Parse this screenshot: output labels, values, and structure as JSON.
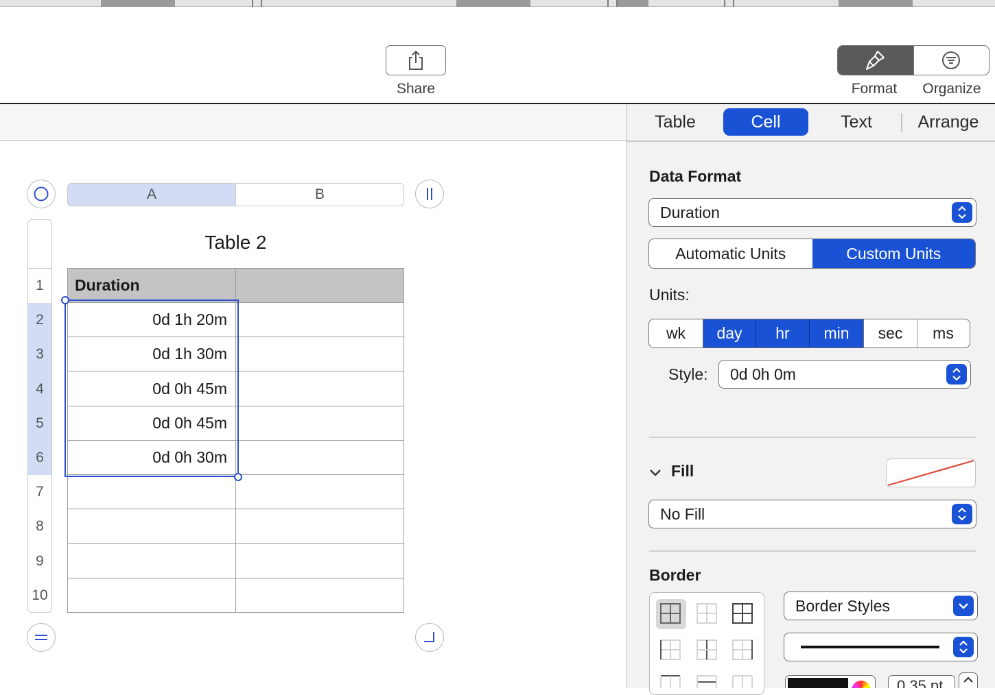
{
  "toolbar": {
    "share_label": "Share",
    "format_label": "Format",
    "organize_label": "Organize",
    "share_icon": "share-icon",
    "format_icon": "paintbrush-icon",
    "organize_icon": "organize-icon"
  },
  "table": {
    "title": "Table 2",
    "columns": [
      "A",
      "B"
    ],
    "row_numbers": [
      "1",
      "2",
      "3",
      "4",
      "5",
      "6",
      "7",
      "8",
      "9",
      "10"
    ],
    "header_cell": "Duration",
    "values": [
      "0d 1h 20m",
      "0d 1h 30m",
      "0d 0h 45m",
      "0d 0h 45m",
      "0d 0h 30m"
    ]
  },
  "sidebar": {
    "tabs": [
      "Table",
      "Cell",
      "Text",
      "Arrange"
    ],
    "active_tab": "Cell",
    "data_format_title": "Data Format",
    "data_format_value": "Duration",
    "unit_modes": [
      "Automatic Units",
      "Custom Units"
    ],
    "active_unit_mode": "Custom Units",
    "units_label": "Units:",
    "units": [
      "wk",
      "day",
      "hr",
      "min",
      "sec",
      "ms"
    ],
    "active_units": [
      "day",
      "hr",
      "min"
    ],
    "style_label": "Style:",
    "style_value": "0d 0h 0m",
    "fill_title": "Fill",
    "fill_value": "No Fill",
    "border_title": "Border",
    "border_styles_value": "Border Styles",
    "border_width_value": "0.35 pt"
  },
  "colors": {
    "accent": "#1a52d6",
    "selection": "#2c4fd0",
    "header_fill": "#c4c4c4"
  }
}
